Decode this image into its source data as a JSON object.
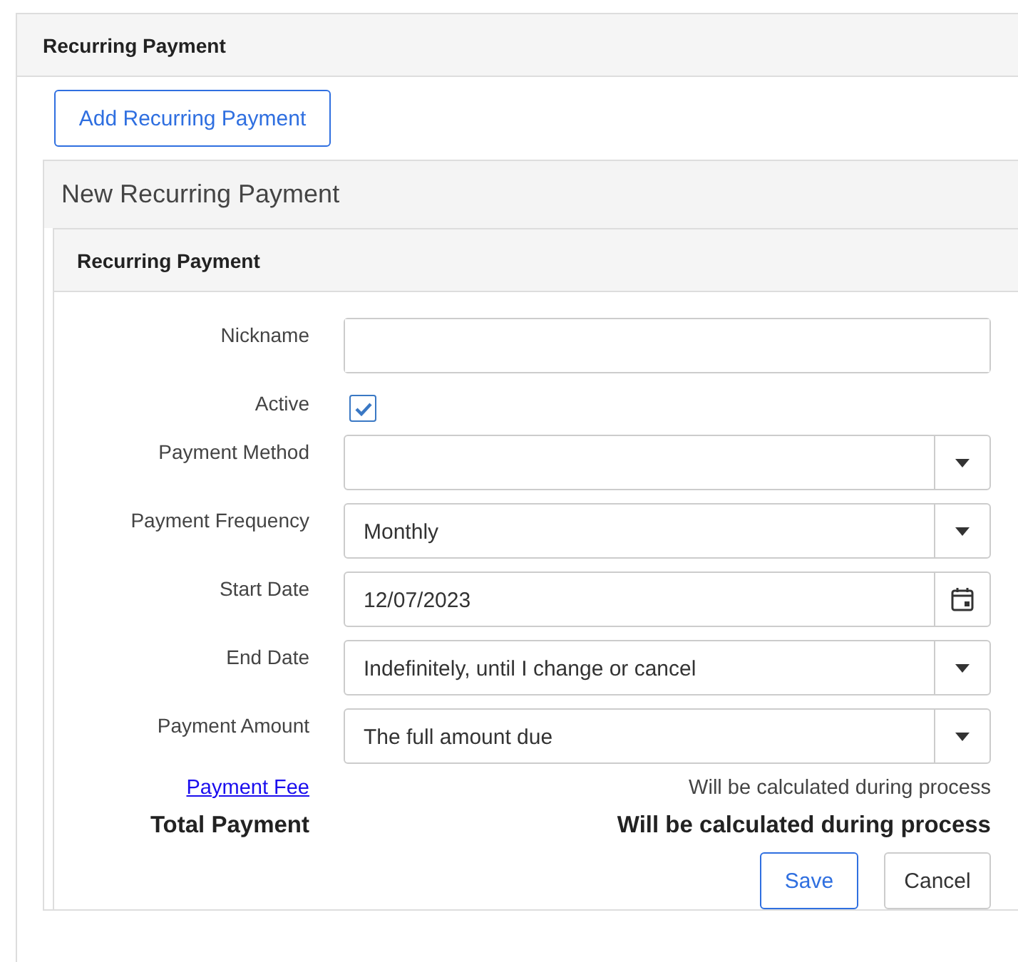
{
  "page_panel": {
    "title": "Recurring Payment",
    "add_button": "Add Recurring Payment"
  },
  "new_panel": {
    "title": "New Recurring Payment"
  },
  "form": {
    "title": "Recurring Payment",
    "fields": [
      {
        "kind": "text",
        "label": "Nickname"
      },
      {
        "kind": "checkbox",
        "label": "Active",
        "checked": true
      },
      {
        "kind": "select",
        "label": "Payment Method"
      },
      {
        "kind": "select",
        "label": "Payment Frequency",
        "value": "Monthly"
      },
      {
        "kind": "date",
        "label": "Start Date",
        "value": "12/07/2023"
      },
      {
        "kind": "select",
        "label": "End Date",
        "value": "Indefinitely, until I change or cancel"
      },
      {
        "kind": "select",
        "label": "Payment Amount",
        "value": "The full amount due"
      }
    ],
    "summary": [
      {
        "kind": "link",
        "label": "Payment Fee",
        "value": "Will be calculated during process"
      },
      {
        "kind": "bold",
        "label": "Total Payment",
        "value": "Will be calculated during process"
      }
    ],
    "buttons": [
      {
        "label": "Save",
        "primary": true
      },
      {
        "label": "Cancel",
        "primary": false
      }
    ]
  }
}
